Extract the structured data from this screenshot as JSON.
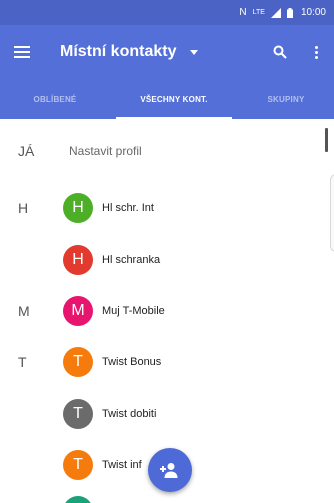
{
  "status_bar": {
    "left_glyph": "N",
    "network": "LTE",
    "time": "10:00"
  },
  "app_bar": {
    "title": "Místní kontakty",
    "icons": [
      "menu-icon",
      "chevron-down-icon",
      "search-icon",
      "more-vert-icon"
    ]
  },
  "tabs": [
    {
      "label": "OBLÍBENÉ",
      "active": false
    },
    {
      "label": "VŠECHNY KONT.",
      "active": true
    },
    {
      "label": "SKUPINY",
      "active": false
    }
  ],
  "profile": {
    "letter": "JÁ",
    "label": "Nastavit profil"
  },
  "contacts": [
    {
      "letter": "H",
      "initial": "H",
      "name": "Hl schr. Int",
      "color": "#4caf27"
    },
    {
      "letter": "",
      "initial": "H",
      "name": "Hl schranka",
      "color": "#e23a2e"
    },
    {
      "letter": "M",
      "initial": "M",
      "name": "Muj T-Mobile",
      "color": "#e8156e"
    },
    {
      "letter": "T",
      "initial": "T",
      "name": "Twist Bonus",
      "color": "#f57c0c"
    },
    {
      "letter": "",
      "initial": "T",
      "name": "Twist dobiti",
      "color": "#6b6b6b"
    },
    {
      "letter": "",
      "initial": "T",
      "name": "Twist inf",
      "color": "#f57c0c"
    }
  ],
  "fab": {
    "icon": "add-contact-icon"
  },
  "colors": {
    "primary": "#5470d8",
    "status": "#4a63c4"
  }
}
